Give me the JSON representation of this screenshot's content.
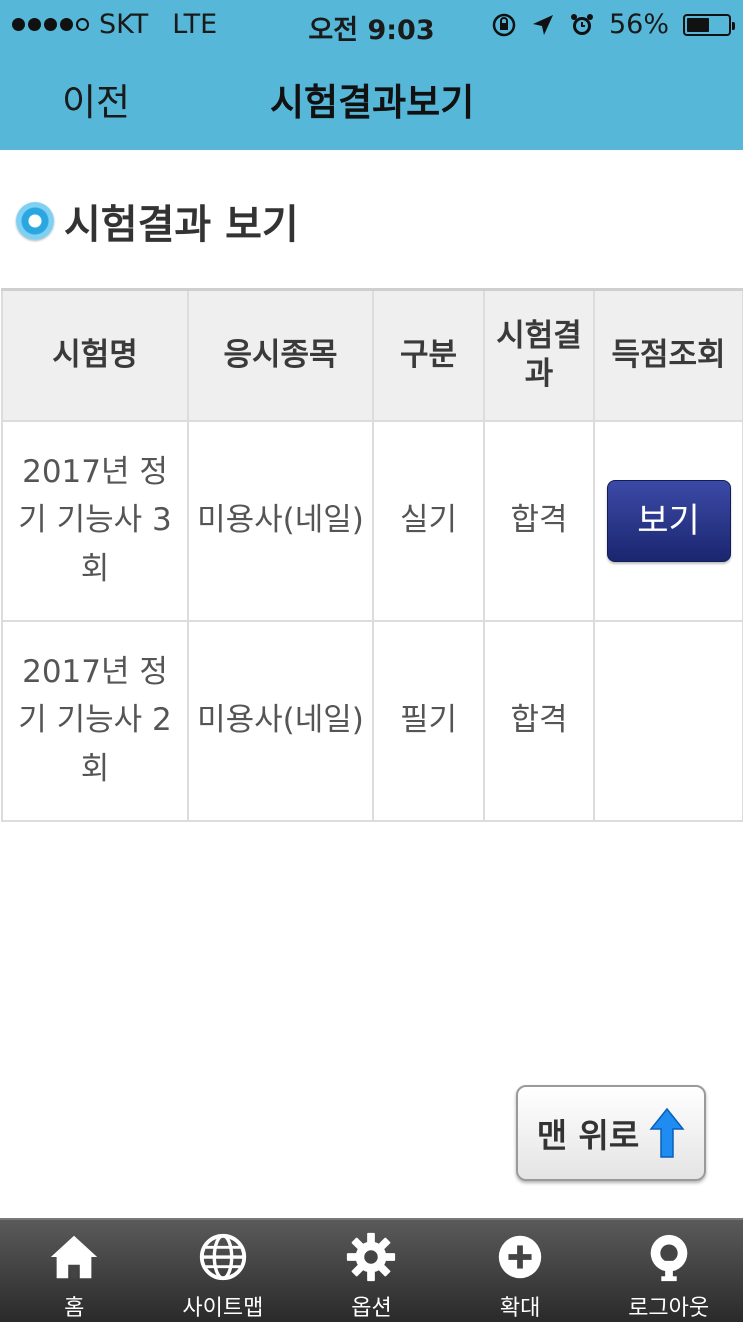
{
  "status_bar": {
    "carrier": "SKT",
    "network": "LTE",
    "time": "오전 9:03",
    "battery": "56%",
    "battery_level": 0.56
  },
  "header": {
    "back_label": "이전",
    "title": "시험결과보기"
  },
  "section": {
    "title": "시험결과 보기"
  },
  "table": {
    "headers": [
      "시험명",
      "응시종목",
      "구분",
      "시험결과",
      "득점조회"
    ],
    "rows": [
      {
        "exam": "2017년 정기 기능사 3회",
        "subject": "미용사(네일)",
        "type": "실기",
        "result": "합격",
        "score_button": "보기"
      },
      {
        "exam": "2017년 정기 기능사 2회",
        "subject": "미용사(네일)",
        "type": "필기",
        "result": "합격",
        "score_button": ""
      }
    ]
  },
  "scroll_top": {
    "label": "맨 위로",
    "icon": "up-arrow-icon"
  },
  "tabbar": {
    "items": [
      {
        "label": "홈",
        "icon": "home-icon"
      },
      {
        "label": "사이트맵",
        "icon": "globe-icon"
      },
      {
        "label": "옵션",
        "icon": "gear-icon"
      },
      {
        "label": "확대",
        "icon": "plus-circle-icon"
      },
      {
        "label": "로그아웃",
        "icon": "logout-icon"
      }
    ]
  },
  "colors": {
    "header_bg": "#56b7d9",
    "button_bg": "#1b2670",
    "accent_arrow": "#1e8cf0"
  }
}
